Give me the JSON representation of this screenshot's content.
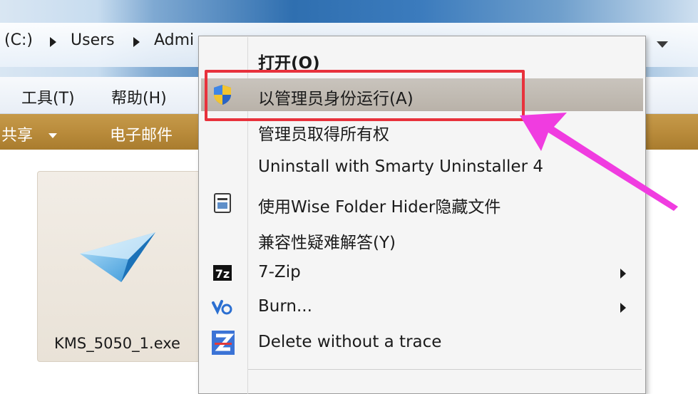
{
  "explorer": {
    "breadcrumbs": [
      "(C:)",
      "Users",
      "Admi"
    ],
    "menu_bar": [
      "工具(T)",
      "帮助(H)"
    ],
    "command_bar": [
      "共享",
      "电子邮件"
    ],
    "file": {
      "name": "KMS_5050_1.exe",
      "icon": "paper-plane-icon"
    }
  },
  "context_menu": {
    "items": [
      {
        "label": "打开(O)",
        "icon": ""
      },
      {
        "label": "以管理员身份运行(A)",
        "icon": "uac-shield-icon",
        "highlighted": true
      },
      {
        "label": "管理员取得所有权",
        "icon": ""
      },
      {
        "label": "Uninstall with Smarty Uninstaller 4",
        "icon": ""
      },
      {
        "label": "使用Wise Folder Hider隐藏文件",
        "icon": "wise-folder-hider-icon"
      },
      {
        "label": "兼容性疑难解答(Y)",
        "icon": ""
      },
      {
        "label": "7-Zip",
        "icon": "7zip-icon",
        "submenu": true
      },
      {
        "label": "Burn...",
        "icon": "burn-icon",
        "submenu": true
      },
      {
        "label": "Delete without a trace",
        "icon": "delete-trace-icon"
      }
    ]
  },
  "colors": {
    "highlight_box": "#e8323c",
    "annotation_arrow": "#f03ce0",
    "hover_item": "#bfb9b1",
    "command_bar": "#b88a3a"
  }
}
